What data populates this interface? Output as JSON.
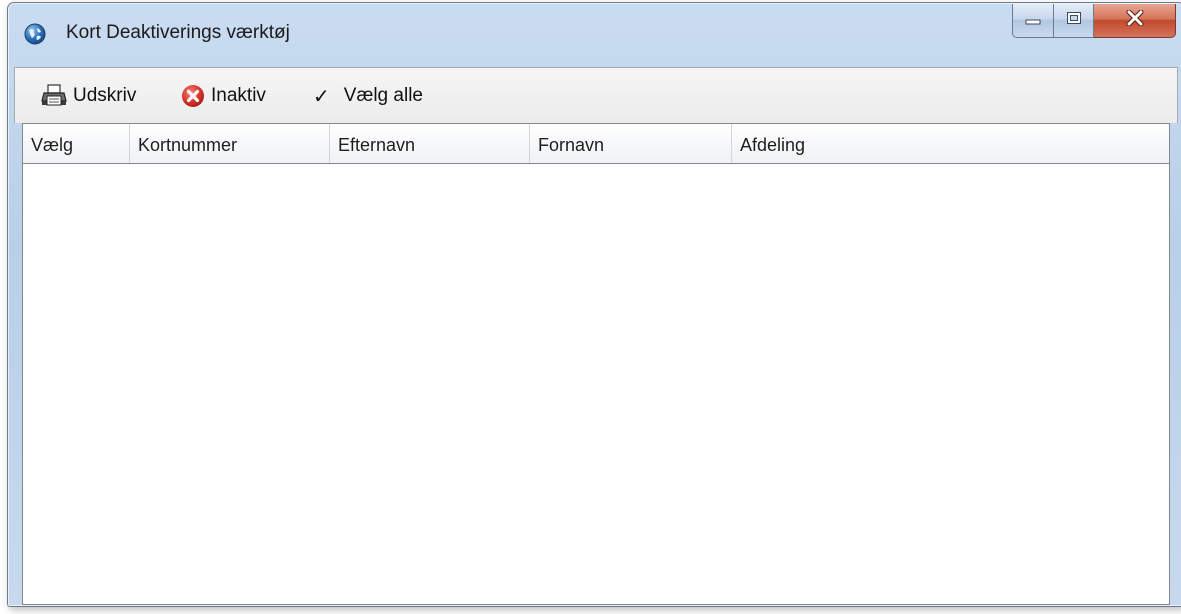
{
  "window": {
    "title": "Kort Deaktiverings værktøj",
    "icons": {
      "app": "globe-icon",
      "minimize": "minimize-icon",
      "maximize": "maximize-icon",
      "close": "close-icon"
    },
    "colors": {
      "close_button": "#c8553a",
      "titlebar": "#c2d6ee"
    }
  },
  "toolbar": {
    "print_label": "Udskriv",
    "print_icon": "printer-icon",
    "inactive_label": "Inaktiv",
    "inactive_icon": "red-x-circle-icon",
    "select_all_label": "Vælg alle",
    "select_all_icon": "checkmark-icon"
  },
  "table": {
    "columns": [
      "Vælg",
      "Kortnummer",
      "Efternavn",
      "Fornavn",
      "Afdeling"
    ],
    "rows": []
  }
}
